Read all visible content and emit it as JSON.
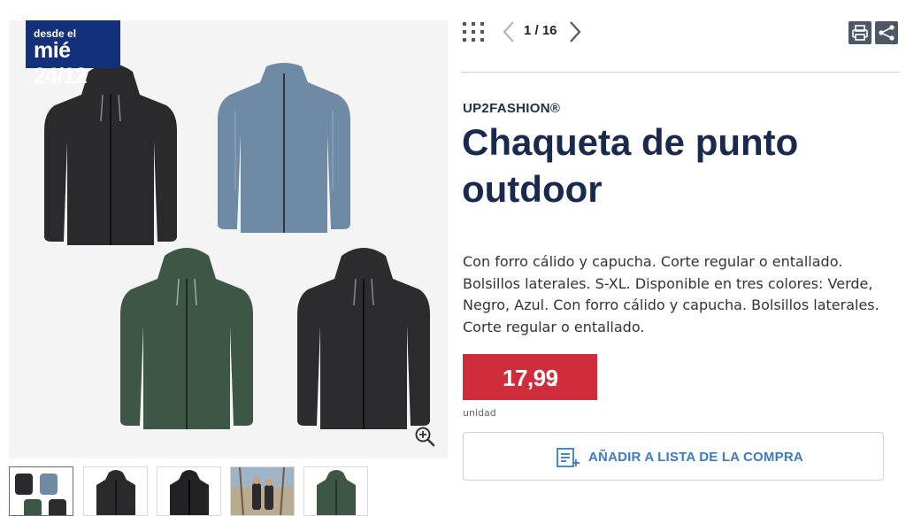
{
  "badge": {
    "line1": "desde el",
    "line2": "mié 24/12"
  },
  "nav": {
    "counter": "1 / 16"
  },
  "product": {
    "brand": "UP2FASHION®",
    "title": "Chaqueta de punto outdoor",
    "description": "Con forro cálido y capucha. Corte regular o entallado. Bolsillos laterales. S-XL. Disponible en tres colores: Verde, Negro, Azul. Con forro cálido y capucha. Bolsillos laterales. Corte regular o entallado.",
    "price": "17,99",
    "currency": "€",
    "unit": "unidad"
  },
  "actions": {
    "add_to_list": "AÑADIR A LISTA DE LA COMPRA"
  },
  "icons": {
    "grid": "grid-dots-icon",
    "prev": "chevron-left-icon",
    "next": "chevron-right-icon",
    "print": "print-icon",
    "share": "share-icon",
    "zoom": "zoom-in-icon",
    "list": "shopping-list-add-icon"
  },
  "colors": {
    "badge_bg": "#13317a",
    "price_bg": "#cf2d3c",
    "title": "#1a2a4e",
    "link_blue": "#3a7bc4",
    "jacket_black": "#2a2a2c",
    "jacket_blue": "#6f8aa5",
    "jacket_green": "#3d5646"
  },
  "gallery": {
    "jackets": [
      "black",
      "blue",
      "green",
      "black"
    ],
    "thumbnails": [
      "all-colors",
      "black",
      "black",
      "people-outdoor",
      "green"
    ]
  }
}
